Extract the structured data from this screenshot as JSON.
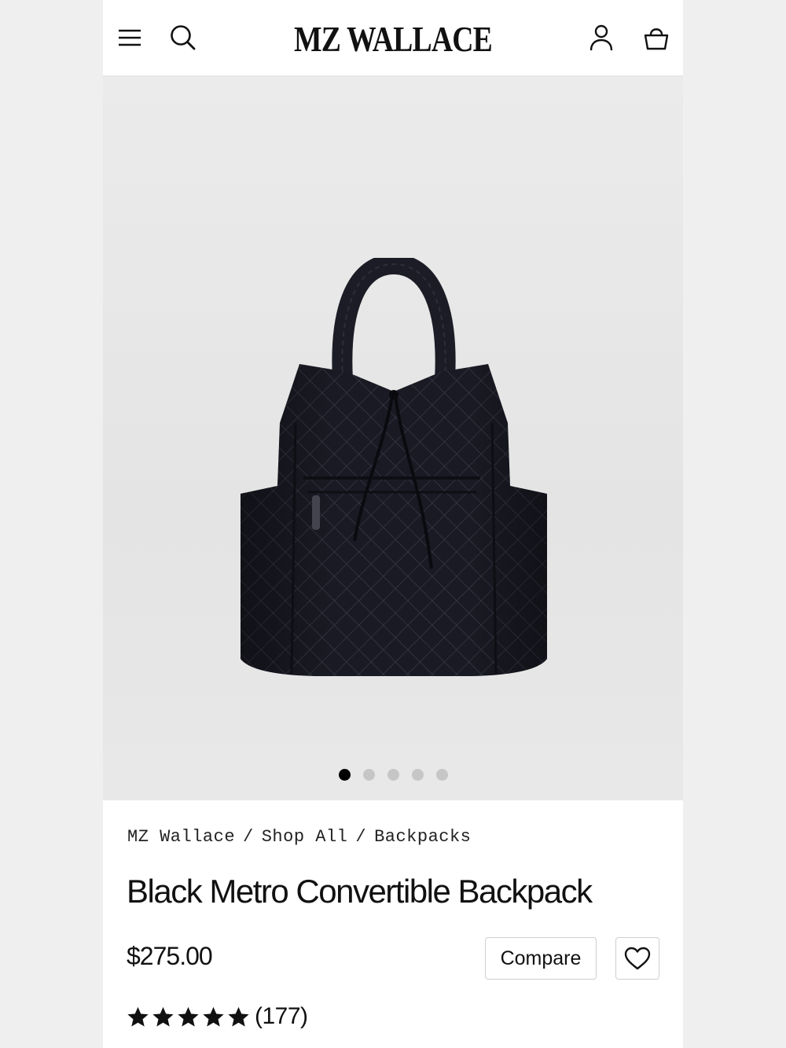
{
  "header": {
    "brand": "MZ WALLACE",
    "icons": [
      "menu-icon",
      "search-icon",
      "account-icon",
      "cart-icon"
    ]
  },
  "gallery": {
    "total_images": 5,
    "active_index": 0,
    "image_description_icon": "backpack-image"
  },
  "breadcrumb": {
    "items": [
      "MZ Wallace",
      "Shop All",
      "Backpacks"
    ],
    "separator": "/"
  },
  "product": {
    "title": "Black Metro Convertible Backpack",
    "price": "$275.00",
    "compare_label": "Compare",
    "rating": 5,
    "review_count": "(177)"
  },
  "colors": {
    "text": "#111111",
    "dot_active": "#000000",
    "dot_inactive": "#c6c6c6",
    "border": "#cfcfcf"
  }
}
